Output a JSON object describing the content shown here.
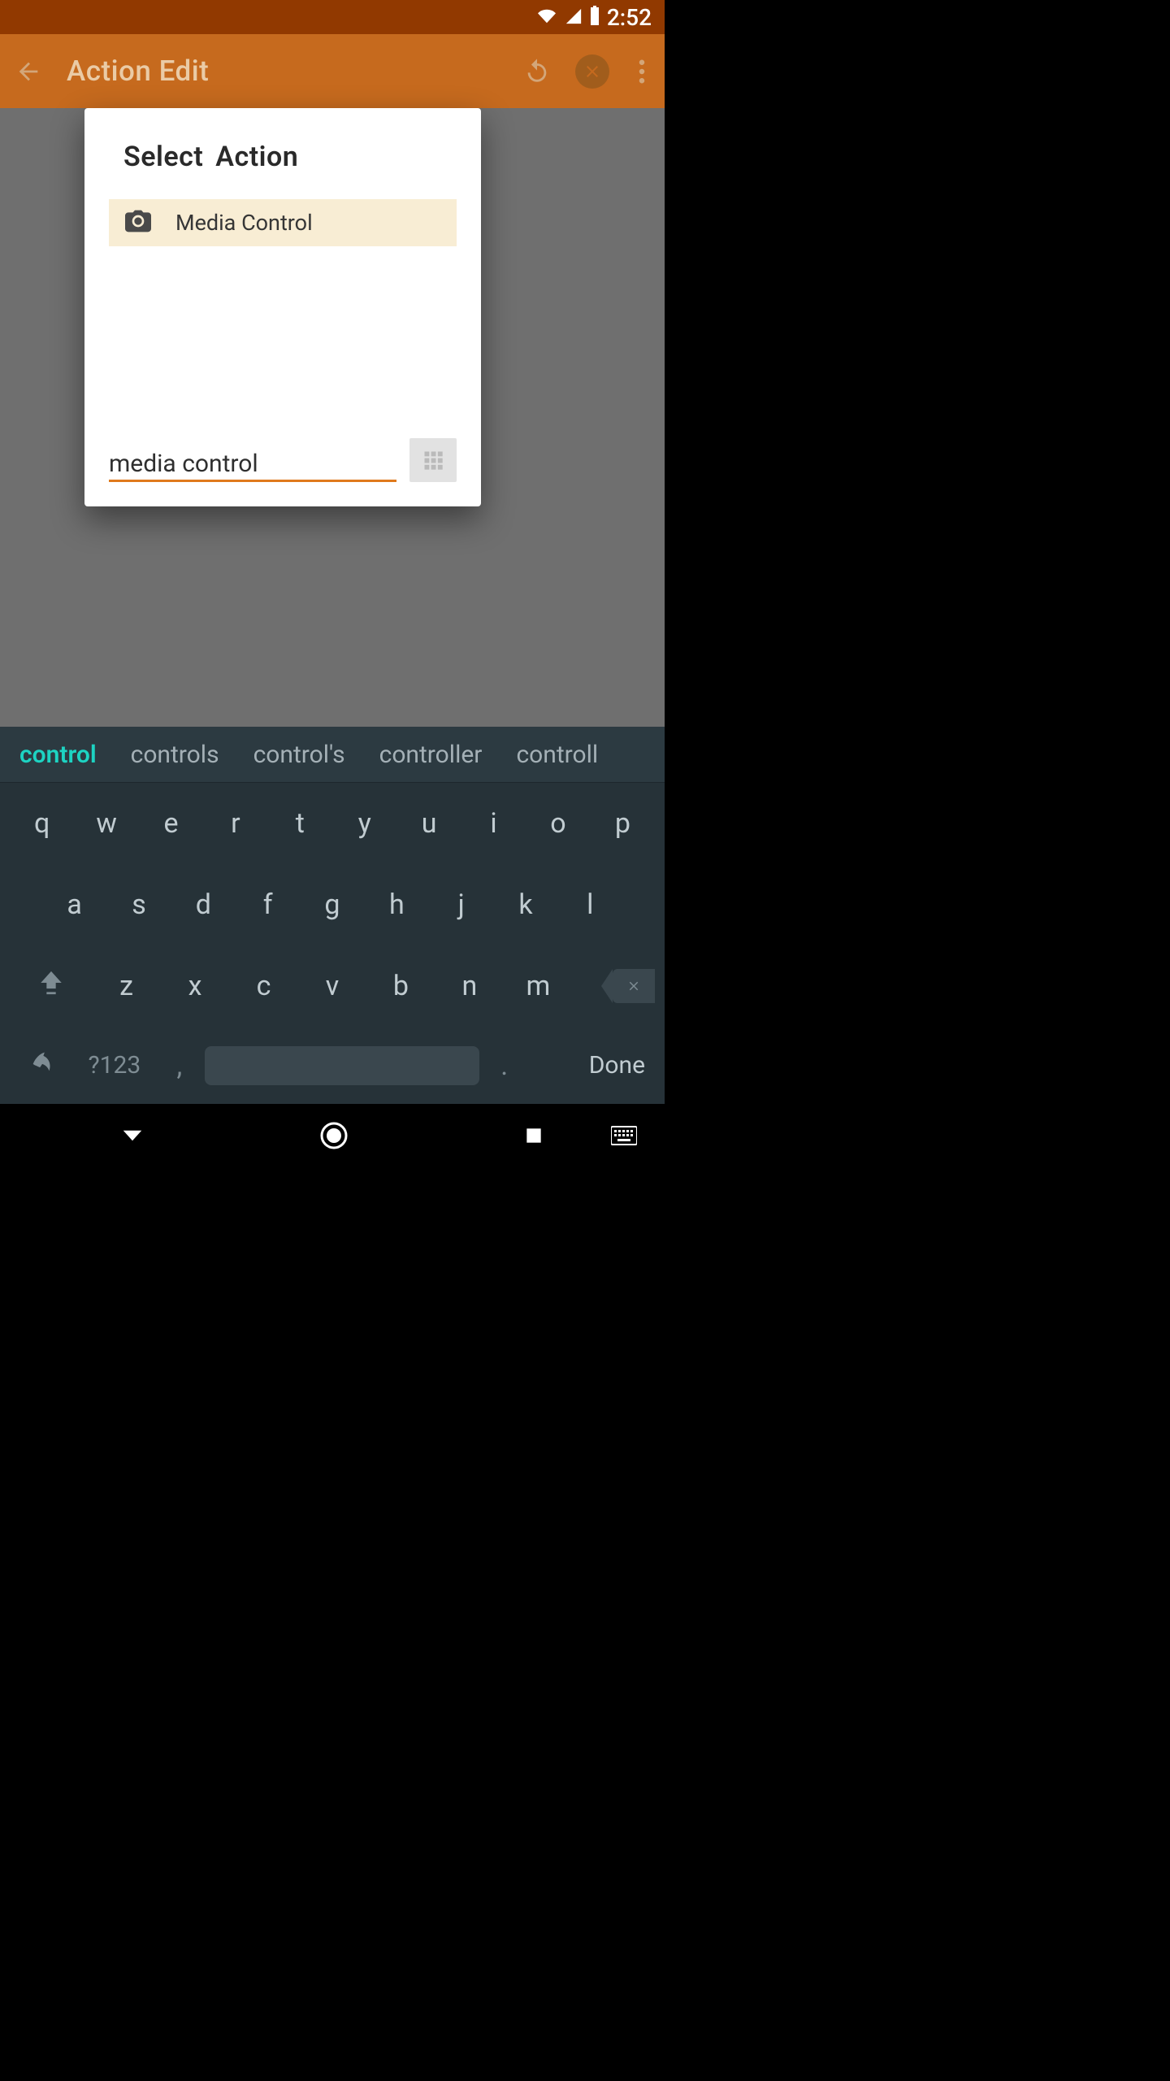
{
  "status": {
    "time": "2:52"
  },
  "appbar": {
    "title": "Action Edit"
  },
  "dialog": {
    "title": "Select  Action",
    "results": [
      {
        "label": "Media Control"
      }
    ],
    "search_value": "media control"
  },
  "keyboard": {
    "suggestions": [
      "control",
      "controls",
      "control's",
      "controller",
      "controll"
    ],
    "row1": [
      "q",
      "w",
      "e",
      "r",
      "t",
      "y",
      "u",
      "i",
      "o",
      "p"
    ],
    "row2": [
      "a",
      "s",
      "d",
      "f",
      "g",
      "h",
      "j",
      "k",
      "l"
    ],
    "row3": [
      "z",
      "x",
      "c",
      "v",
      "b",
      "n",
      "m"
    ],
    "symkey": "?123",
    "comma": ",",
    "period": ".",
    "done": "Done"
  }
}
